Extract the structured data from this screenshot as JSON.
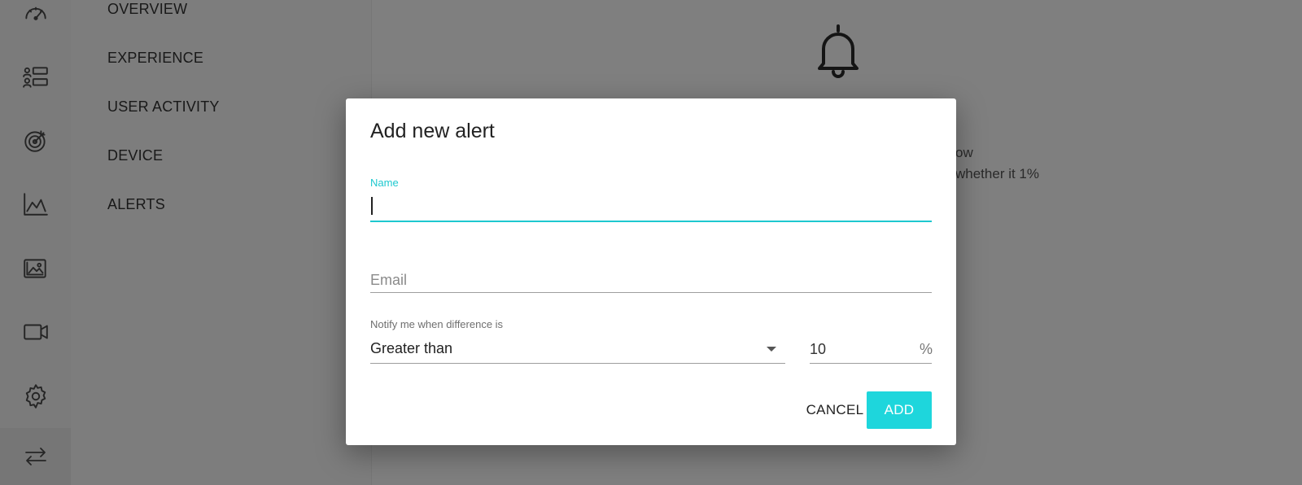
{
  "nav": {
    "rail_icons": [
      "dashboard-gauge-icon",
      "user-list-icon",
      "target-icon",
      "area-chart-icon",
      "image-gallery-icon",
      "video-camera-icon",
      "settings-gear-icon",
      "swap-arrows-icon"
    ],
    "items": [
      "OVERVIEW",
      "EXPERIENCE",
      "USER ACTIVITY",
      "DEVICE",
      "ALERTS"
    ]
  },
  "main": {
    "icon": "bell-icon",
    "text_line1": "ow",
    "text_line2": "whether it 1%"
  },
  "dialog": {
    "title": "Add new alert",
    "name_label": "Name",
    "name_value": "",
    "email_placeholder": "Email",
    "notify_label": "Notify me when difference is",
    "comparison_value": "Greater than",
    "threshold_value": "10",
    "threshold_unit": "%",
    "cancel_label": "CANCEL",
    "add_label": "ADD"
  },
  "colors": {
    "accent": "#1ed6dc",
    "focus": "#1ec8cf"
  }
}
